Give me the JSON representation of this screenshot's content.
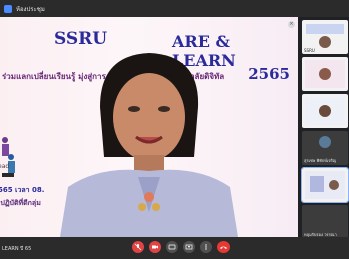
{
  "window": {
    "title": "ห้องประชุม"
  },
  "slide": {
    "brand": "SSRU",
    "headline": "ARE & LEARN",
    "subtitle": "ร่วมแลกเปลี่ยนเรียนรู้ มุ่งสู่การ … ทบดาลใจ สู่มหาวิทยาลัยดิจิทัล",
    "year": "2565",
    "date_line": "565 เวลา 08.",
    "note_line": "เปฏิบัติที่ดีกลุ่ม",
    "side_label": "ead"
  },
  "controls": {
    "bottom_label": "LEARN ปี 65",
    "close_glyph": "×"
  },
  "participants": [
    {
      "name": "SSRU"
    },
    {
      "name": ""
    },
    {
      "name": ""
    },
    {
      "name": "สุรเชษ พิทักษ์เจริญ"
    },
    {
      "name": ""
    },
    {
      "name": "หลุมรับรอง วรรณา"
    }
  ],
  "colors": {
    "accent": "#2a2a9a",
    "end_call": "#e53935"
  }
}
